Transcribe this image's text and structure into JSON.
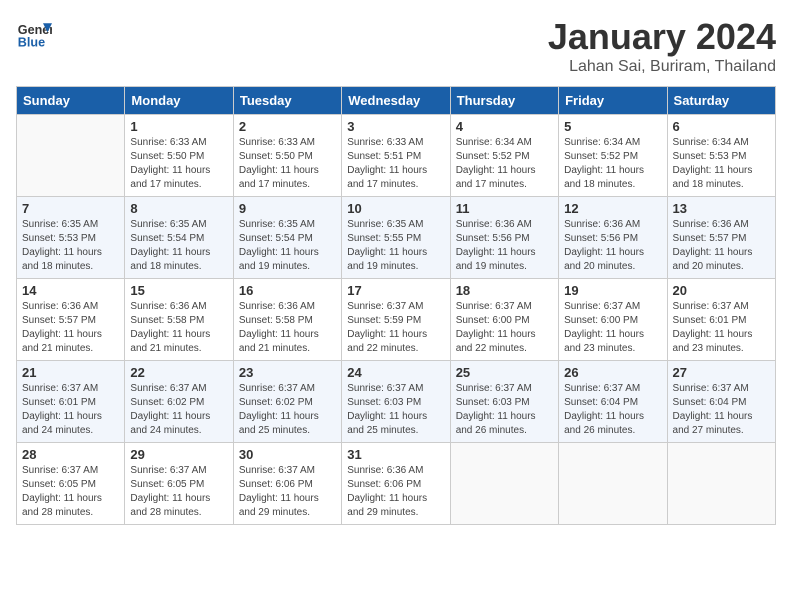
{
  "header": {
    "logo_line1": "General",
    "logo_line2": "Blue",
    "title": "January 2024",
    "subtitle": "Lahan Sai, Buriram, Thailand"
  },
  "days_of_week": [
    "Sunday",
    "Monday",
    "Tuesday",
    "Wednesday",
    "Thursday",
    "Friday",
    "Saturday"
  ],
  "weeks": [
    [
      {
        "num": "",
        "info": ""
      },
      {
        "num": "1",
        "info": "Sunrise: 6:33 AM\nSunset: 5:50 PM\nDaylight: 11 hours\nand 17 minutes."
      },
      {
        "num": "2",
        "info": "Sunrise: 6:33 AM\nSunset: 5:50 PM\nDaylight: 11 hours\nand 17 minutes."
      },
      {
        "num": "3",
        "info": "Sunrise: 6:33 AM\nSunset: 5:51 PM\nDaylight: 11 hours\nand 17 minutes."
      },
      {
        "num": "4",
        "info": "Sunrise: 6:34 AM\nSunset: 5:52 PM\nDaylight: 11 hours\nand 17 minutes."
      },
      {
        "num": "5",
        "info": "Sunrise: 6:34 AM\nSunset: 5:52 PM\nDaylight: 11 hours\nand 18 minutes."
      },
      {
        "num": "6",
        "info": "Sunrise: 6:34 AM\nSunset: 5:53 PM\nDaylight: 11 hours\nand 18 minutes."
      }
    ],
    [
      {
        "num": "7",
        "info": "Sunrise: 6:35 AM\nSunset: 5:53 PM\nDaylight: 11 hours\nand 18 minutes."
      },
      {
        "num": "8",
        "info": "Sunrise: 6:35 AM\nSunset: 5:54 PM\nDaylight: 11 hours\nand 18 minutes."
      },
      {
        "num": "9",
        "info": "Sunrise: 6:35 AM\nSunset: 5:54 PM\nDaylight: 11 hours\nand 19 minutes."
      },
      {
        "num": "10",
        "info": "Sunrise: 6:35 AM\nSunset: 5:55 PM\nDaylight: 11 hours\nand 19 minutes."
      },
      {
        "num": "11",
        "info": "Sunrise: 6:36 AM\nSunset: 5:56 PM\nDaylight: 11 hours\nand 19 minutes."
      },
      {
        "num": "12",
        "info": "Sunrise: 6:36 AM\nSunset: 5:56 PM\nDaylight: 11 hours\nand 20 minutes."
      },
      {
        "num": "13",
        "info": "Sunrise: 6:36 AM\nSunset: 5:57 PM\nDaylight: 11 hours\nand 20 minutes."
      }
    ],
    [
      {
        "num": "14",
        "info": "Sunrise: 6:36 AM\nSunset: 5:57 PM\nDaylight: 11 hours\nand 21 minutes."
      },
      {
        "num": "15",
        "info": "Sunrise: 6:36 AM\nSunset: 5:58 PM\nDaylight: 11 hours\nand 21 minutes."
      },
      {
        "num": "16",
        "info": "Sunrise: 6:36 AM\nSunset: 5:58 PM\nDaylight: 11 hours\nand 21 minutes."
      },
      {
        "num": "17",
        "info": "Sunrise: 6:37 AM\nSunset: 5:59 PM\nDaylight: 11 hours\nand 22 minutes."
      },
      {
        "num": "18",
        "info": "Sunrise: 6:37 AM\nSunset: 6:00 PM\nDaylight: 11 hours\nand 22 minutes."
      },
      {
        "num": "19",
        "info": "Sunrise: 6:37 AM\nSunset: 6:00 PM\nDaylight: 11 hours\nand 23 minutes."
      },
      {
        "num": "20",
        "info": "Sunrise: 6:37 AM\nSunset: 6:01 PM\nDaylight: 11 hours\nand 23 minutes."
      }
    ],
    [
      {
        "num": "21",
        "info": "Sunrise: 6:37 AM\nSunset: 6:01 PM\nDaylight: 11 hours\nand 24 minutes."
      },
      {
        "num": "22",
        "info": "Sunrise: 6:37 AM\nSunset: 6:02 PM\nDaylight: 11 hours\nand 24 minutes."
      },
      {
        "num": "23",
        "info": "Sunrise: 6:37 AM\nSunset: 6:02 PM\nDaylight: 11 hours\nand 25 minutes."
      },
      {
        "num": "24",
        "info": "Sunrise: 6:37 AM\nSunset: 6:03 PM\nDaylight: 11 hours\nand 25 minutes."
      },
      {
        "num": "25",
        "info": "Sunrise: 6:37 AM\nSunset: 6:03 PM\nDaylight: 11 hours\nand 26 minutes."
      },
      {
        "num": "26",
        "info": "Sunrise: 6:37 AM\nSunset: 6:04 PM\nDaylight: 11 hours\nand 26 minutes."
      },
      {
        "num": "27",
        "info": "Sunrise: 6:37 AM\nSunset: 6:04 PM\nDaylight: 11 hours\nand 27 minutes."
      }
    ],
    [
      {
        "num": "28",
        "info": "Sunrise: 6:37 AM\nSunset: 6:05 PM\nDaylight: 11 hours\nand 28 minutes."
      },
      {
        "num": "29",
        "info": "Sunrise: 6:37 AM\nSunset: 6:05 PM\nDaylight: 11 hours\nand 28 minutes."
      },
      {
        "num": "30",
        "info": "Sunrise: 6:37 AM\nSunset: 6:06 PM\nDaylight: 11 hours\nand 29 minutes."
      },
      {
        "num": "31",
        "info": "Sunrise: 6:36 AM\nSunset: 6:06 PM\nDaylight: 11 hours\nand 29 minutes."
      },
      {
        "num": "",
        "info": ""
      },
      {
        "num": "",
        "info": ""
      },
      {
        "num": "",
        "info": ""
      }
    ]
  ]
}
